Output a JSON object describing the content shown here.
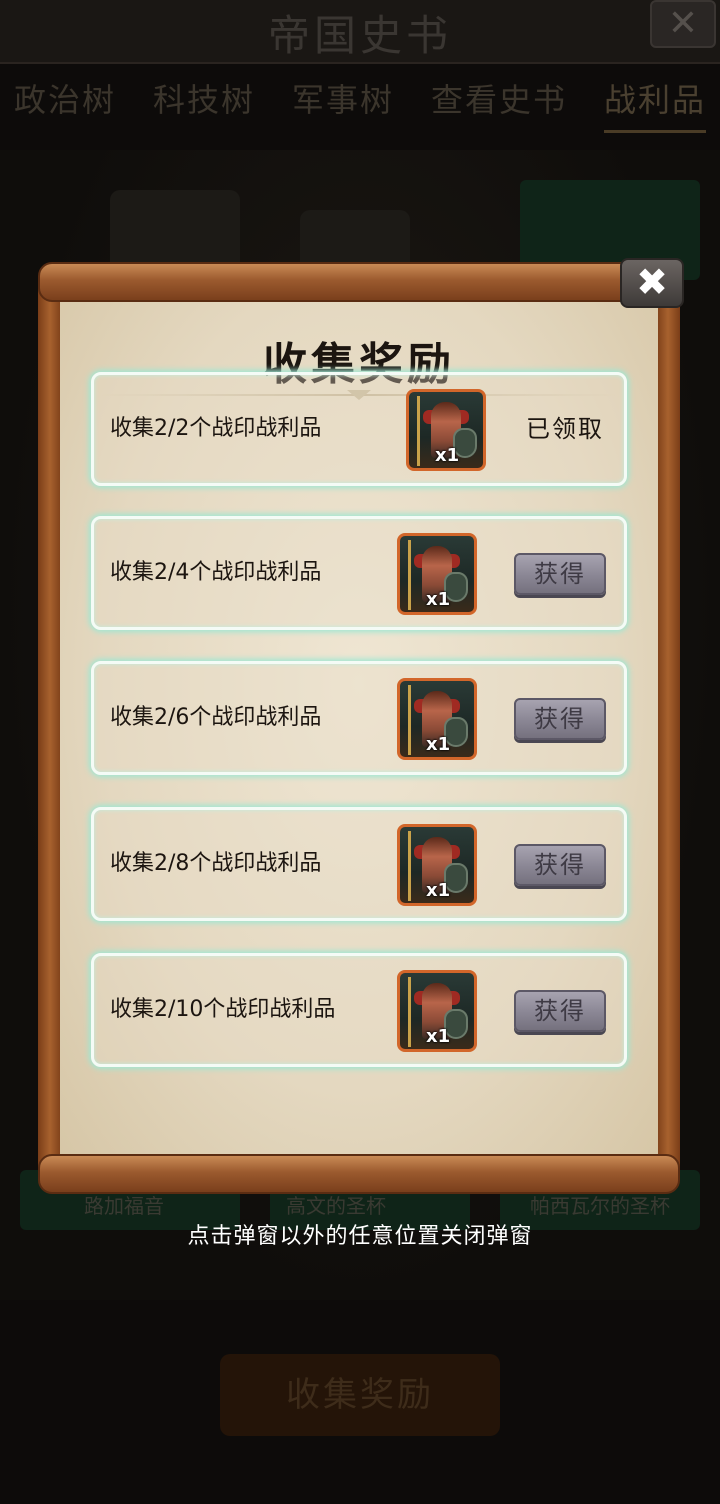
{
  "background": {
    "title": "帝国史书",
    "close_icon": "close-icon",
    "tabs": [
      "政治树",
      "科技树",
      "军事树",
      "查看史书",
      "战利品"
    ],
    "active_tab": "战利品",
    "item_labels": [
      "路加福音",
      "高文的圣杯",
      "帕西瓦尔的圣杯"
    ],
    "bottom_button": "收集奖励"
  },
  "popup": {
    "title": "收集奖励",
    "close_icon": "close-icon",
    "rows": [
      {
        "label": "收集2/2个战印战利品",
        "reward_qty": "x1",
        "status": "已领取",
        "state": "claimed"
      },
      {
        "label": "收集2/4个战印战利品",
        "reward_qty": "x1",
        "status": "获得",
        "state": "locked"
      },
      {
        "label": "收集2/6个战印战利品",
        "reward_qty": "x1",
        "status": "获得",
        "state": "locked"
      },
      {
        "label": "收集2/8个战印战利品",
        "reward_qty": "x1",
        "status": "获得",
        "state": "locked"
      },
      {
        "label": "收集2/10个战印战利品",
        "reward_qty": "x1",
        "status": "获得",
        "state": "locked"
      }
    ]
  },
  "hint": "点击弹窗以外的任意位置关闭弹窗",
  "colors": {
    "accent_glow": "#9fe7d3",
    "icon_border": "#d2662a",
    "button_disabled": "#8a8694"
  }
}
